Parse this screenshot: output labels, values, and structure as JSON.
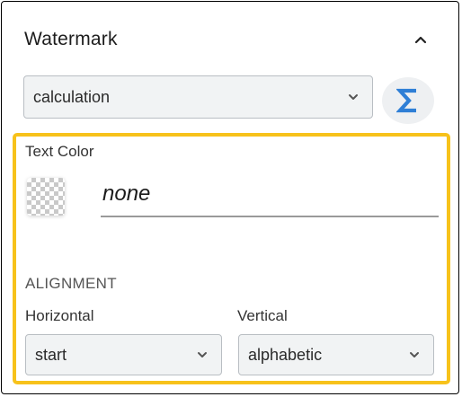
{
  "panel": {
    "title": "Watermark",
    "collapse_icon": "chevron-up-icon"
  },
  "calculation": {
    "selected": "calculation",
    "sigma_icon": "sigma-icon",
    "sigma_color": "#2f7fd6"
  },
  "text_color": {
    "label": "Text Color",
    "value": "none"
  },
  "alignment": {
    "section_label": "ALIGNMENT",
    "horizontal": {
      "label": "Horizontal",
      "selected": "start"
    },
    "vertical": {
      "label": "Vertical",
      "selected": "alphabetic"
    }
  },
  "colors": {
    "highlight_border": "#f7c21b",
    "select_background": "#f1f3f4"
  }
}
